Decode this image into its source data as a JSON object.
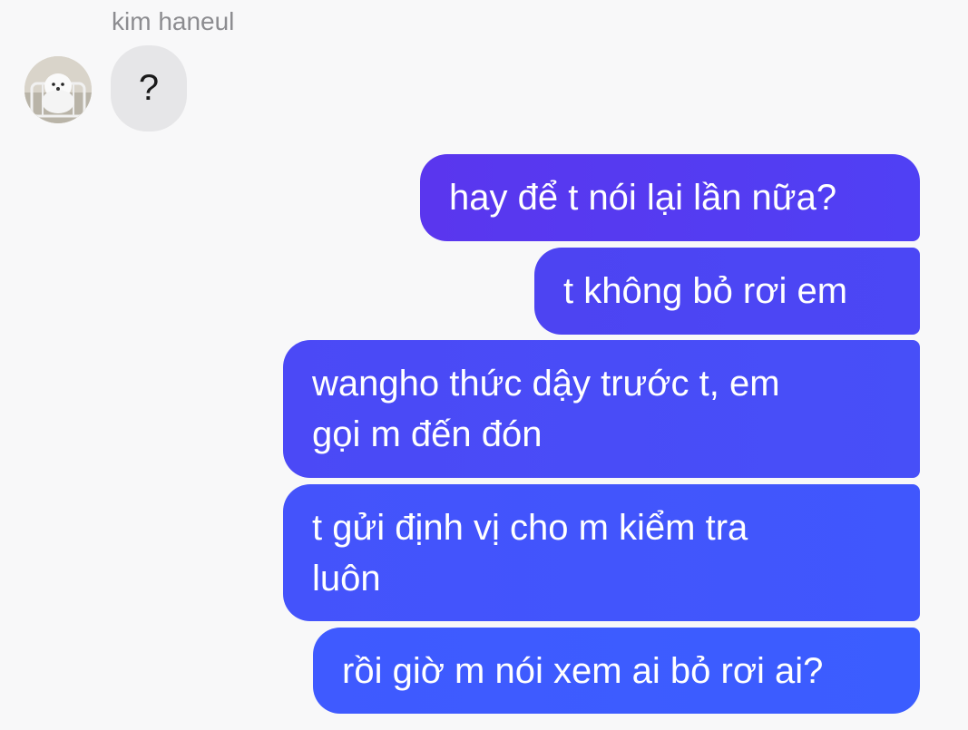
{
  "thread": {
    "sender_name": "kim haneul",
    "avatar_icon": "dog-photo-avatar"
  },
  "messages": {
    "incoming": [
      {
        "text": "?"
      }
    ],
    "outgoing": [
      {
        "text": "hay để t nói lại lần nữa?"
      },
      {
        "text": "t không bỏ rơi em"
      },
      {
        "text": "wangho thức dậy trước t, em\ngọi m đến đón"
      },
      {
        "text": "t gửi định vị cho m kiểm tra\nluôn"
      },
      {
        "text": "rồi giờ m nói xem ai bỏ rơi ai?"
      }
    ]
  },
  "colors": {
    "background": "#f8f8f9",
    "incoming_bubble": "#e6e6e8",
    "outgoing_top": "#5a36ee",
    "outgoing_bottom": "#3b5dff",
    "sender_name": "#8c8c90"
  }
}
